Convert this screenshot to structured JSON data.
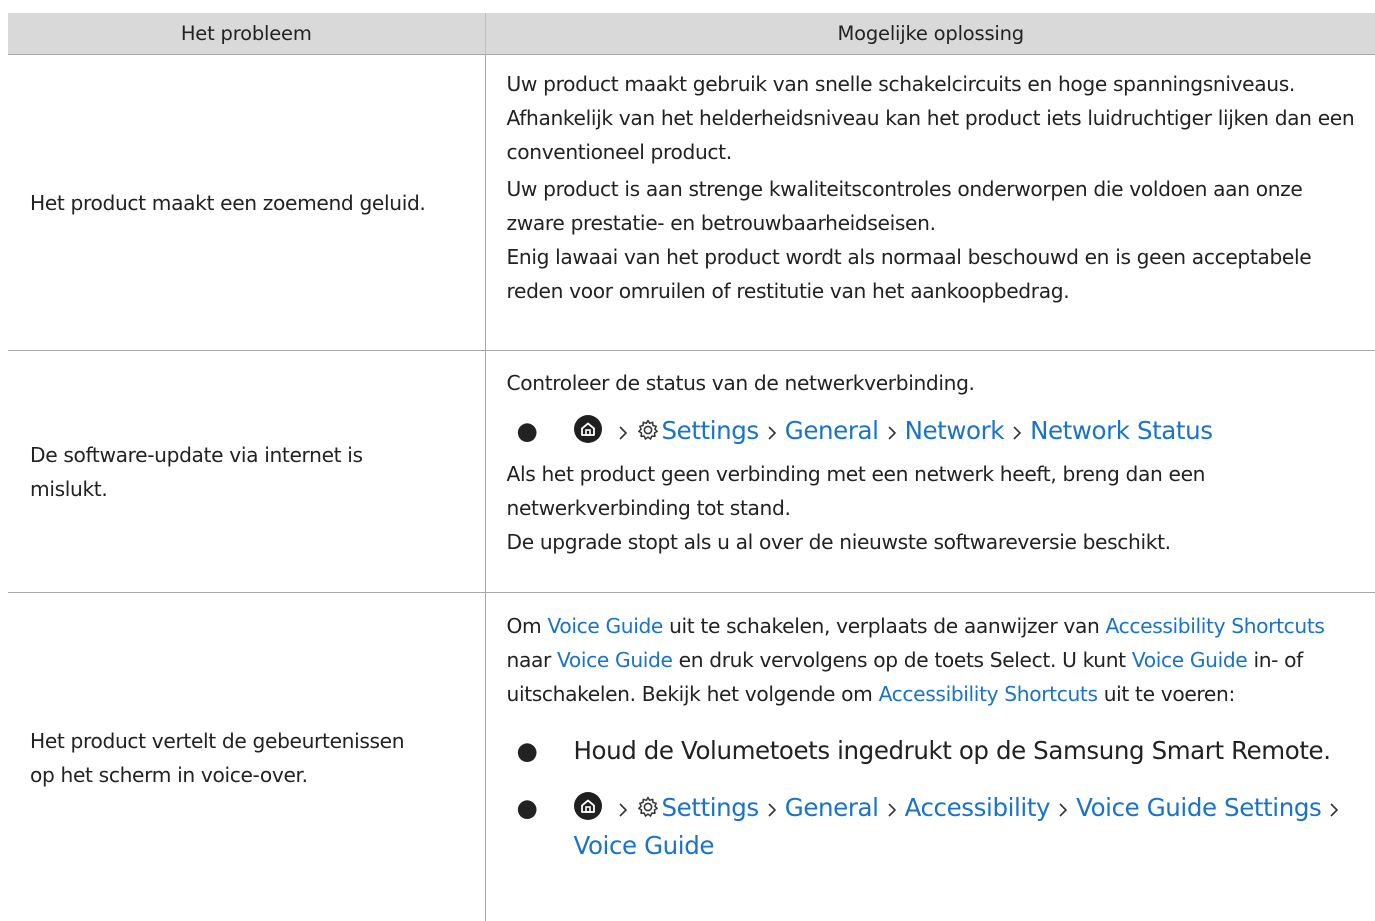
{
  "table": {
    "headers": [
      "Het probleem",
      "Mogelijke oplossing"
    ],
    "rows": [
      {
        "problem": [
          "Het product maakt een zoemend geluid."
        ],
        "solution": {
          "p1": "Uw product maakt gebruik van snelle schakelcircuits en hoge spanningsniveaus. Afhankelijk van het helderheidsniveau kan het product iets luidruchtiger lijken dan een conventioneel product.",
          "p2": "Uw product is aan strenge kwaliteitscontroles onderworpen die voldoen aan onze zware prestatie- en betrouwbaarheidseisen.",
          "p3": "Enig lawaai van het product wordt als normaal beschouwd en is geen acceptabele reden voor omruilen of restitutie van het aankoopbedrag."
        }
      },
      {
        "problem": [
          "De software-update via internet is",
          "mislukt."
        ],
        "solution": {
          "p1": "Controleer de status van de netwerkverbinding.",
          "menu_path": [
            "Settings",
            "General",
            "Network",
            "Network Status"
          ],
          "p2": "Als het product geen verbinding met een netwerk heeft, breng dan een netwerkverbinding tot stand.",
          "p3": "De upgrade stopt als u al over de nieuwste softwareversie beschikt."
        }
      },
      {
        "problem": [
          "Het product vertelt de gebeurtenissen",
          "op het scherm in voice-over."
        ],
        "solution": {
          "p1_parts": [
            {
              "text": "Om ",
              "link": false
            },
            {
              "text": "Voice Guide",
              "link": true
            },
            {
              "text": " uit te schakelen, verplaats de aanwijzer van ",
              "link": false
            },
            {
              "text": "Accessibility Shortcuts",
              "link": true
            },
            {
              "text": " naar ",
              "link": false
            },
            {
              "text": "Voice Guide",
              "link": true
            },
            {
              "text": " en druk vervolgens op de toets Select. U kunt ",
              "link": false
            },
            {
              "text": "Voice Guide",
              "link": true
            },
            {
              "text": " in- of uitschakelen. Bekijk het volgende om ",
              "link": false
            },
            {
              "text": "Accessibility Shortcuts",
              "link": true
            },
            {
              "text": " uit te voeren:",
              "link": false
            }
          ],
          "bullet1": "Houd de Volumetoets ingedrukt op de Samsung Smart Remote.",
          "menu_path": [
            "Settings",
            "General",
            "Accessibility",
            "Voice Guide Settings",
            "Voice Guide"
          ]
        }
      }
    ]
  },
  "icons": {
    "bullet": "●",
    "home": "home-icon",
    "gear": "settings-gear-icon",
    "chevron": "chevron-right-icon"
  },
  "colors": {
    "header_bg": "#d9d9d9",
    "link": "#1a73c8",
    "border": "#a8a8a8",
    "text": "#222222"
  }
}
